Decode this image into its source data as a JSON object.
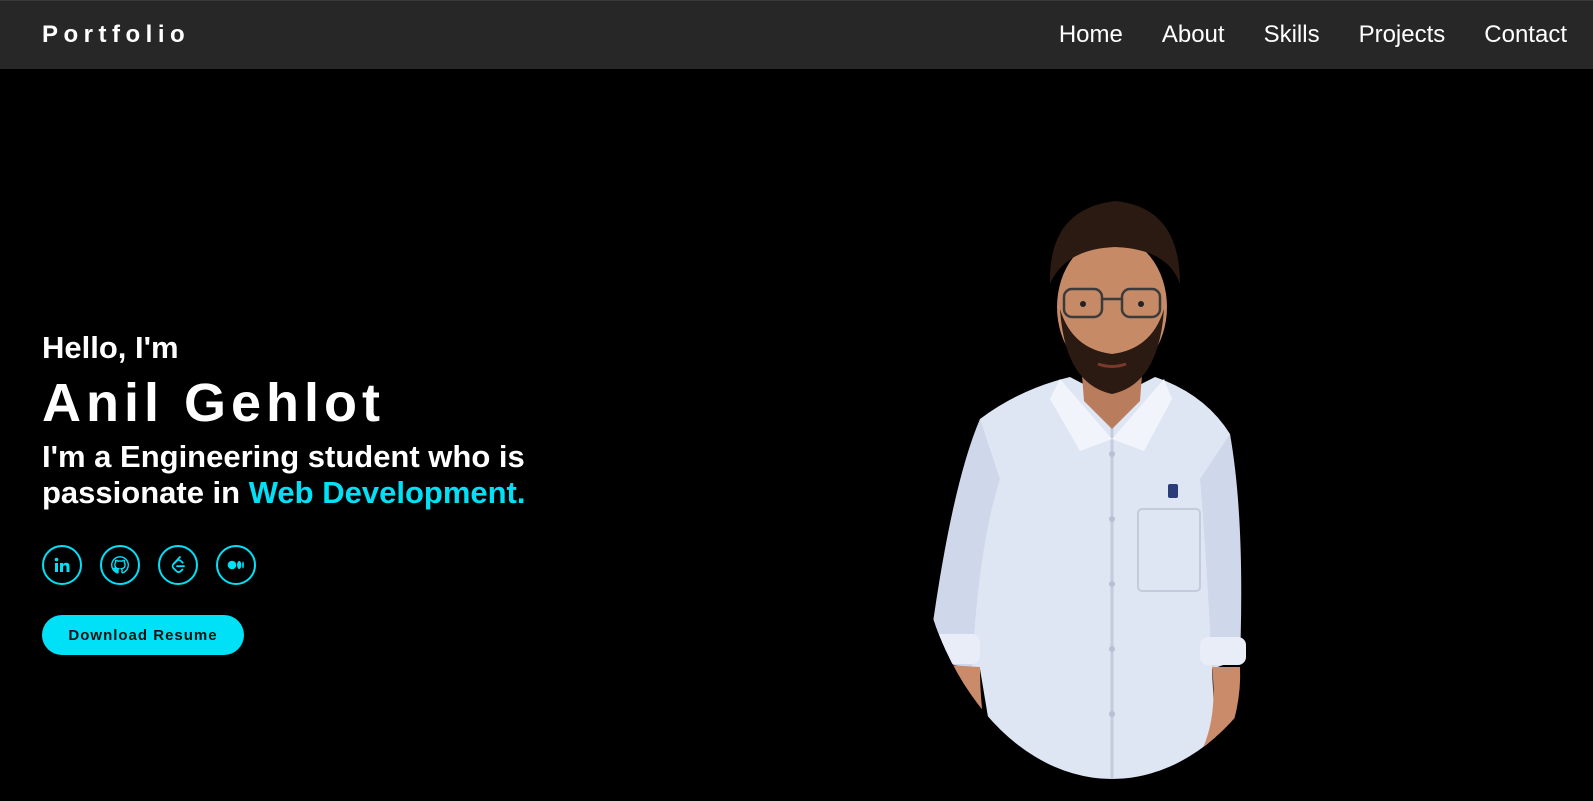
{
  "nav": {
    "brand": "Portfolio",
    "links": [
      "Home",
      "About",
      "Skills",
      "Projects",
      "Contact"
    ]
  },
  "hero": {
    "greeting": "Hello, I'm",
    "name": "Anil Gehlot",
    "tagline_start": "I'm a Engineering student who is passionate in ",
    "tagline_highlight": "Web Development.",
    "socials": [
      "linkedin-icon",
      "github-icon",
      "leetcode-icon",
      "medium-icon"
    ],
    "resume_button": "Download Resume"
  },
  "colors": {
    "accent": "#00e1f7",
    "navbar_bg": "#272727",
    "page_bg": "#000000"
  }
}
